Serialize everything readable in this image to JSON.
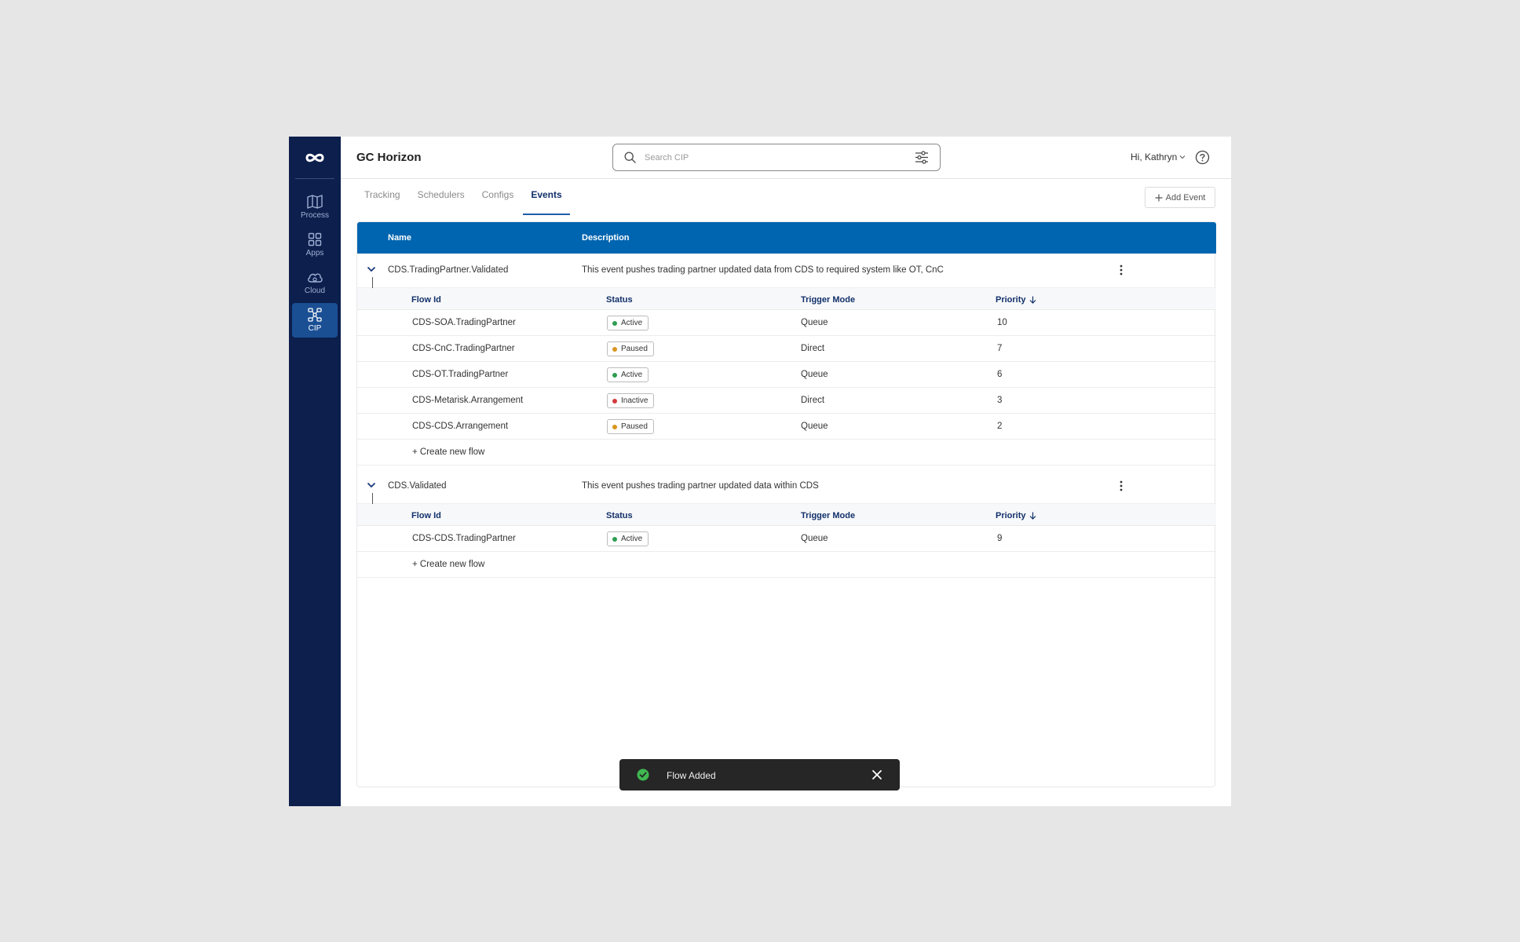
{
  "app": {
    "title": "GC Horizon"
  },
  "sidebar": {
    "items": [
      {
        "label": "Process",
        "icon": "map-icon"
      },
      {
        "label": "Apps",
        "icon": "grid-icon"
      },
      {
        "label": "Cloud",
        "icon": "cloud-icon"
      },
      {
        "label": "CIP",
        "icon": "network-icon",
        "active": true
      }
    ]
  },
  "search": {
    "placeholder": "Search CIP"
  },
  "user": {
    "greeting": "Hi, Kathryn"
  },
  "tabs": [
    {
      "label": "Tracking"
    },
    {
      "label": "Schedulers"
    },
    {
      "label": "Configs"
    },
    {
      "label": "Events",
      "active": true
    }
  ],
  "toolbar": {
    "add_event_label": "Add Event"
  },
  "table": {
    "columns": {
      "name": "Name",
      "description": "Description"
    },
    "sub_columns": {
      "flow_id": "Flow Id",
      "status": "Status",
      "trigger_mode": "Trigger Mode",
      "priority": "Priority"
    },
    "create_label": "+ Create new flow",
    "events": [
      {
        "name": "CDS.TradingPartner.Validated",
        "description": "This event pushes trading partner updated data from CDS to required system like OT, CnC",
        "flows": [
          {
            "flow_id": "CDS-SOA.TradingPartner",
            "status": "Active",
            "trigger_mode": "Queue",
            "priority": "10"
          },
          {
            "flow_id": "CDS-CnC.TradingPartner",
            "status": "Paused",
            "trigger_mode": "Direct",
            "priority": "7"
          },
          {
            "flow_id": "CDS-OT.TradingPartner",
            "status": "Active",
            "trigger_mode": "Queue",
            "priority": "6"
          },
          {
            "flow_id": "CDS-Metarisk.Arrangement",
            "status": "Inactive",
            "trigger_mode": "Direct",
            "priority": "3"
          },
          {
            "flow_id": "CDS-CDS.Arrangement",
            "status": "Paused",
            "trigger_mode": "Queue",
            "priority": "2"
          }
        ]
      },
      {
        "name": "CDS.Validated",
        "description": "This event pushes trading partner updated data within CDS",
        "flows": [
          {
            "flow_id": "CDS-CDS.TradingPartner",
            "status": "Active",
            "trigger_mode": "Queue",
            "priority": "9"
          }
        ]
      }
    ]
  },
  "status_colors": {
    "Active": "#2e9e4f",
    "Paused": "#d9951f",
    "Inactive": "#d23b3b"
  },
  "toast": {
    "message": "Flow Added"
  },
  "colors": {
    "sidebar": "#0c1f4d",
    "header_row": "#0065b0",
    "accent": "#1f5ea8"
  }
}
